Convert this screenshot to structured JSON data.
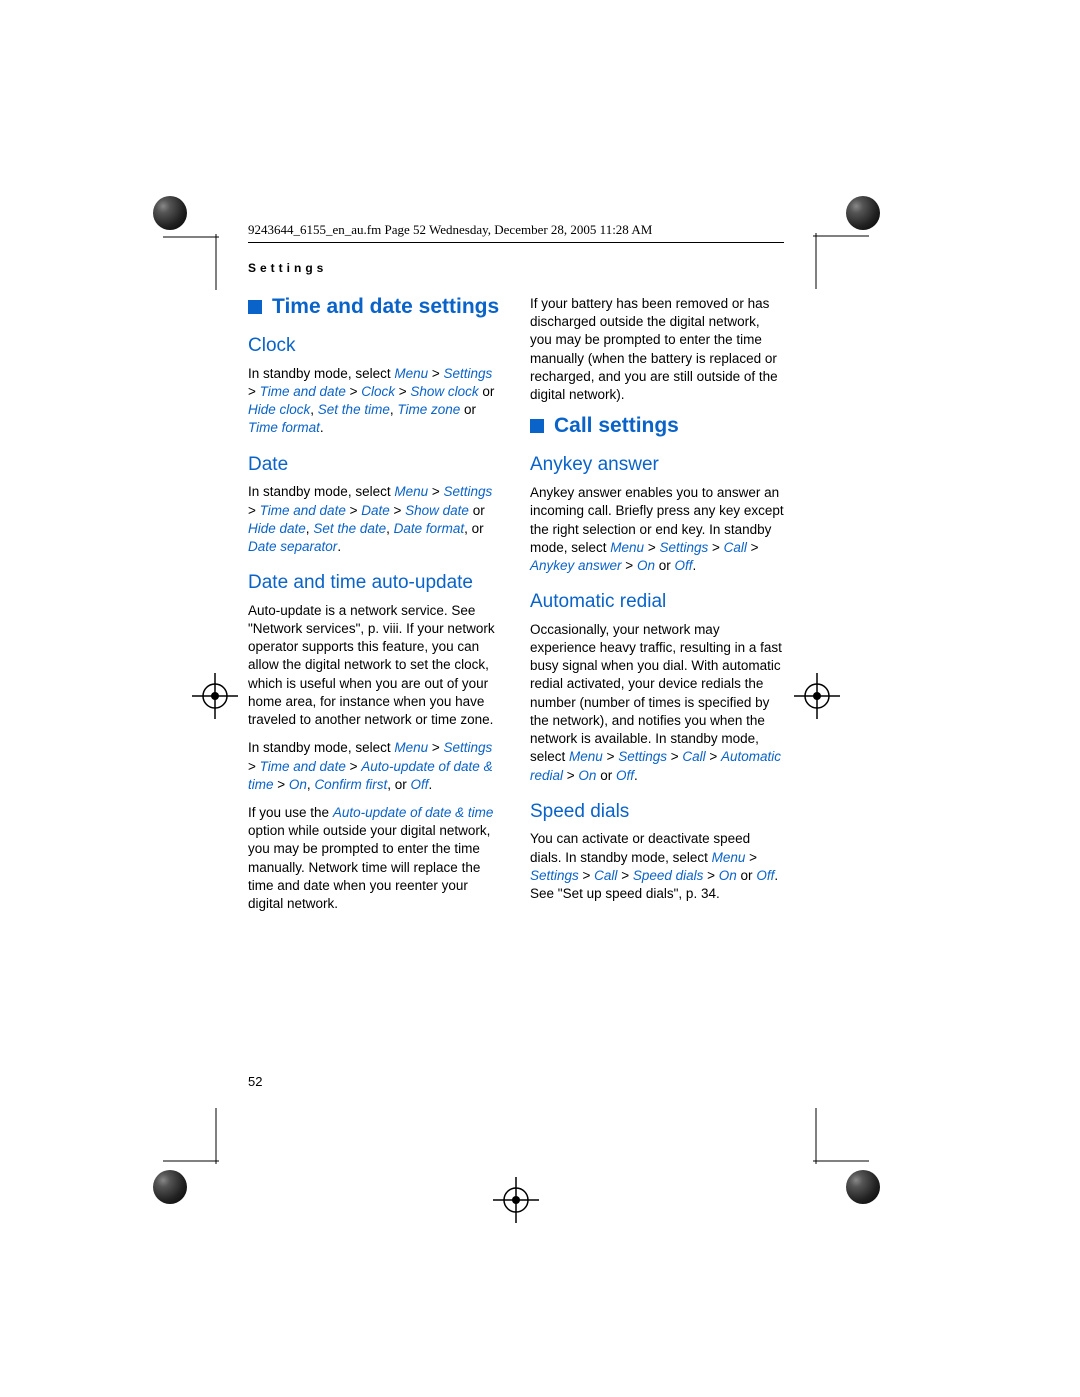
{
  "header": {
    "file_line": "9243644_6155_en_au.fm  Page 52  Wednesday, December 28, 2005  11:28 AM",
    "running_head": "Settings"
  },
  "left": {
    "h1": "Time and date settings",
    "clock": {
      "title": "Clock",
      "p1a": "In standby mode, select ",
      "p1b": "Menu",
      "p1c": " > ",
      "p1d": "Settings",
      "p1e": " > ",
      "p1f": "Time and date",
      "p1g": " > ",
      "p1h": "Clock",
      "p1i": " > ",
      "p1j": "Show clock",
      "p1k": " or ",
      "p1l": "Hide clock",
      "p1m": ", ",
      "p1n": "Set the time",
      "p1o": ", ",
      "p1p": "Time zone",
      "p1q": " or ",
      "p1r": "Time format",
      "p1s": "."
    },
    "date": {
      "title": "Date",
      "p1a": "In standby mode, select ",
      "p1b": "Menu",
      "p1c": " > ",
      "p1d": "Settings",
      "p1e": " > ",
      "p1f": "Time and date",
      "p1g": " > ",
      "p1h": "Date",
      "p1i": " > ",
      "p1j": "Show date",
      "p1k": " or ",
      "p1l": "Hide date",
      "p1m": ", ",
      "p1n": "Set the date",
      "p1o": ", ",
      "p1p": "Date format",
      "p1q": ", or ",
      "p1r": "Date separator",
      "p1s": "."
    },
    "auto": {
      "title": "Date and time auto-update",
      "p1": "Auto-update is a network service. See \"Network services\", p. viii. If your network operator supports this feature, you can allow the digital network to set the clock, which is useful when you are out of your home area, for instance when you have traveled to another network or time zone.",
      "p2a": "In standby mode, select ",
      "p2b": "Menu",
      "p2c": " > ",
      "p2d": "Settings",
      "p2e": " > ",
      "p2f": "Time and date",
      "p2g": " > ",
      "p2h": "Auto-update of date & time",
      "p2i": " > ",
      "p2j": "On",
      "p2k": ", ",
      "p2l": "Confirm first",
      "p2m": ", or ",
      "p2n": "Off",
      "p2o": ".",
      "p3a": "If you use the ",
      "p3b": "Auto-update of date & time",
      "p3c": " option while outside your digital network, you may be prompted to enter the time manually. Network time will replace the time and date when you reenter your digital network."
    }
  },
  "right": {
    "battery": "If your battery has been removed or has discharged outside the digital network, you may be prompted to enter the time manually (when the battery is replaced or recharged, and you are still outside of the digital network).",
    "h1": "Call settings",
    "anykey": {
      "title": "Anykey answer",
      "p1a": "Anykey answer enables you to answer an incoming call. Briefly press any key except the right selection or end key. In standby mode, select ",
      "p1b": "Menu",
      "p1c": " > ",
      "p1d": "Settings",
      "p1e": " > ",
      "p1f": "Call",
      "p1g": " > ",
      "p1h": "Anykey answer",
      "p1i": " > ",
      "p1j": "On",
      "p1k": " or ",
      "p1l": "Off",
      "p1m": "."
    },
    "redial": {
      "title": "Automatic redial",
      "p1a": "Occasionally, your network may experience heavy traffic, resulting in a fast busy signal when you dial. With automatic redial activated, your device redials the number (number of times is specified by the network), and notifies you when the network is available. In standby mode, select ",
      "p1b": "Menu",
      "p1c": " > ",
      "p1d": "Settings",
      "p1e": " > ",
      "p1f": "Call",
      "p1g": " > ",
      "p1h": "Automatic redial",
      "p1i": " > ",
      "p1j": "On",
      "p1k": " or ",
      "p1l": "Off",
      "p1m": "."
    },
    "speed": {
      "title": "Speed dials",
      "p1a": "You can activate or deactivate speed dials. In standby mode, select ",
      "p1b": "Menu",
      "p1c": " > ",
      "p1d": "Settings",
      "p1e": " > ",
      "p1f": "Call",
      "p1g": " > ",
      "p1h": "Speed dials",
      "p1i": " > ",
      "p1j": "On",
      "p1k": " or ",
      "p1l": "Off",
      "p1m": ". See \"Set up speed dials\", p. 34."
    }
  },
  "pagenum": "52"
}
